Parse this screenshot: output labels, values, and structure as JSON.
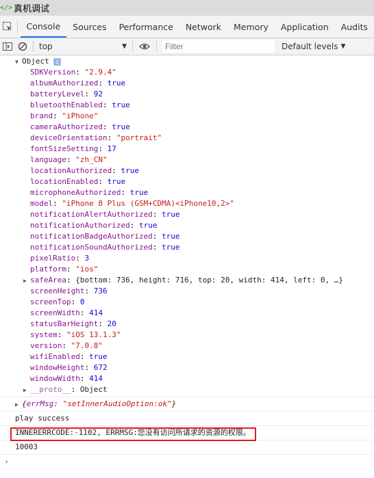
{
  "window": {
    "title": "真机调试"
  },
  "tabs": [
    {
      "label": "Console",
      "active": true
    },
    {
      "label": "Sources"
    },
    {
      "label": "Performance"
    },
    {
      "label": "Network"
    },
    {
      "label": "Memory"
    },
    {
      "label": "Application"
    },
    {
      "label": "Audits"
    }
  ],
  "toolbar": {
    "context": "top",
    "filter_placeholder": "Filter",
    "levels": "Default levels"
  },
  "object": {
    "label": "Object",
    "props": [
      {
        "key": "SDKVersion",
        "value": "\"2.9.4\"",
        "type": "string"
      },
      {
        "key": "albumAuthorized",
        "value": "true",
        "type": "bool"
      },
      {
        "key": "batteryLevel",
        "value": "92",
        "type": "number"
      },
      {
        "key": "bluetoothEnabled",
        "value": "true",
        "type": "bool"
      },
      {
        "key": "brand",
        "value": "\"iPhone\"",
        "type": "string"
      },
      {
        "key": "cameraAuthorized",
        "value": "true",
        "type": "bool"
      },
      {
        "key": "deviceOrientation",
        "value": "\"portrait\"",
        "type": "string"
      },
      {
        "key": "fontSizeSetting",
        "value": "17",
        "type": "number"
      },
      {
        "key": "language",
        "value": "\"zh_CN\"",
        "type": "string"
      },
      {
        "key": "locationAuthorized",
        "value": "true",
        "type": "bool"
      },
      {
        "key": "locationEnabled",
        "value": "true",
        "type": "bool"
      },
      {
        "key": "microphoneAuthorized",
        "value": "true",
        "type": "bool"
      },
      {
        "key": "model",
        "value": "\"iPhone 8 Plus (GSM+CDMA)<iPhone10,2>\"",
        "type": "string"
      },
      {
        "key": "notificationAlertAuthorized",
        "value": "true",
        "type": "bool"
      },
      {
        "key": "notificationAuthorized",
        "value": "true",
        "type": "bool"
      },
      {
        "key": "notificationBadgeAuthorized",
        "value": "true",
        "type": "bool"
      },
      {
        "key": "notificationSoundAuthorized",
        "value": "true",
        "type": "bool"
      },
      {
        "key": "pixelRatio",
        "value": "3",
        "type": "number"
      },
      {
        "key": "platform",
        "value": "\"ios\"",
        "type": "string"
      },
      {
        "key": "safeArea",
        "value": "{bottom: 736, height: 716, top: 20, width: 414, left: 0, …}",
        "type": "plain",
        "expandable": true
      },
      {
        "key": "screenHeight",
        "value": "736",
        "type": "number"
      },
      {
        "key": "screenTop",
        "value": "0",
        "type": "number"
      },
      {
        "key": "screenWidth",
        "value": "414",
        "type": "number"
      },
      {
        "key": "statusBarHeight",
        "value": "20",
        "type": "number"
      },
      {
        "key": "system",
        "value": "\"iOS 13.1.3\"",
        "type": "string"
      },
      {
        "key": "version",
        "value": "\"7.0.8\"",
        "type": "string"
      },
      {
        "key": "wifiEnabled",
        "value": "true",
        "type": "bool"
      },
      {
        "key": "windowHeight",
        "value": "672",
        "type": "number"
      },
      {
        "key": "windowWidth",
        "value": "414",
        "type": "number"
      },
      {
        "key": "__proto__",
        "value": "Object",
        "type": "plain",
        "expandable": true,
        "proto": true
      }
    ]
  },
  "messages": {
    "errmsg_key": "errMsg",
    "errmsg_value": "\"setInnerAudioOption:ok\"",
    "play": "play success",
    "error": "INNERERRCODE:-1102, ERRMSG:您没有访问所请求的资源的权限。",
    "code": "10003"
  },
  "colors": {
    "highlight_box": "#e21a1a",
    "tab_underline": "#1a73e8"
  }
}
